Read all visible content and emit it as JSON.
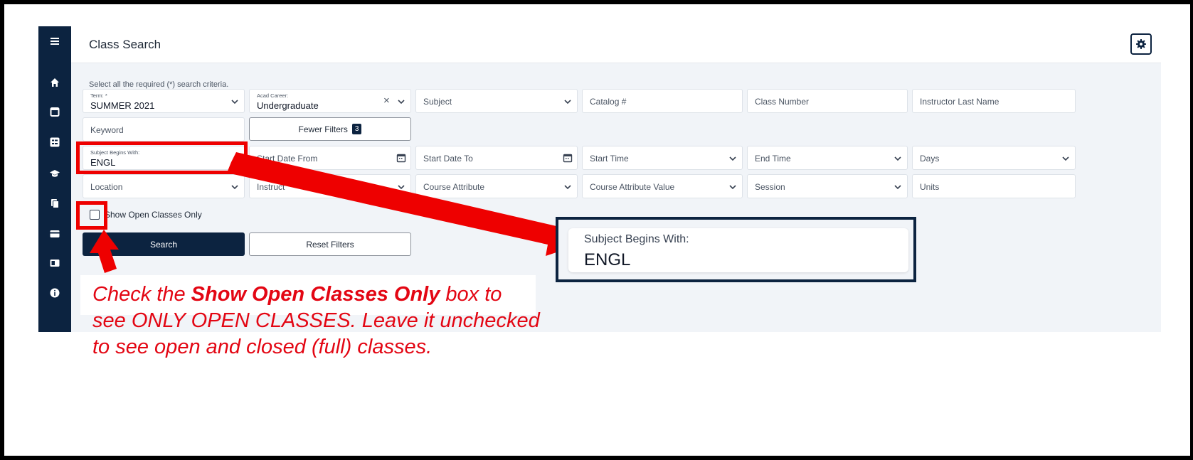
{
  "header": {
    "title": "Class Search"
  },
  "hint": "Select all the required (*) search criteria.",
  "filters": {
    "term": {
      "label": "Term: *",
      "value": "SUMMER 2021"
    },
    "acad_career": {
      "label": "Acad Career:",
      "value": "Undergraduate",
      "clear": "×"
    },
    "subject": "Subject",
    "catalog": "Catalog #",
    "class_number": "Class Number",
    "instructor_last": "Instructor Last Name",
    "keyword": "Keyword",
    "fewer_filters": {
      "label": "Fewer Filters",
      "count": "3"
    },
    "subject_begins": {
      "label": "Subject Begins With:",
      "value": "ENGL"
    },
    "start_date_from": "Start Date From",
    "start_date_to": "Start Date To",
    "start_time": "Start Time",
    "end_time": "End Time",
    "days": "Days",
    "location": "Location",
    "instructor": "Instruct",
    "course_attribute": "Course Attribute",
    "course_attribute_value": "Course Attribute Value",
    "session": "Session",
    "units": "Units"
  },
  "show_open": {
    "label": "Show Open Classes Only",
    "checked": false
  },
  "buttons": {
    "search": "Search",
    "reset": "Reset Filters"
  },
  "zoom": {
    "label": "Subject Begins With:",
    "value": "ENGL"
  },
  "callout": {
    "part1": "Check the ",
    "bold": "Show Open Classes Only",
    "part2": " box to see ONLY OPEN CLASSES. Leave it unchecked to see open and closed (full) classes."
  },
  "colors": {
    "navy": "#0c2340",
    "annotation_red": "#ee0000",
    "panel_bg": "#f1f4f8"
  },
  "icons": [
    "menu-icon",
    "home-icon",
    "calendar-icon",
    "class-search-icon",
    "graduation-cap-icon",
    "documents-icon",
    "card-icon",
    "id-card-icon",
    "info-icon",
    "gear-icon",
    "chevron-down-icon",
    "calendar-picker-icon"
  ]
}
